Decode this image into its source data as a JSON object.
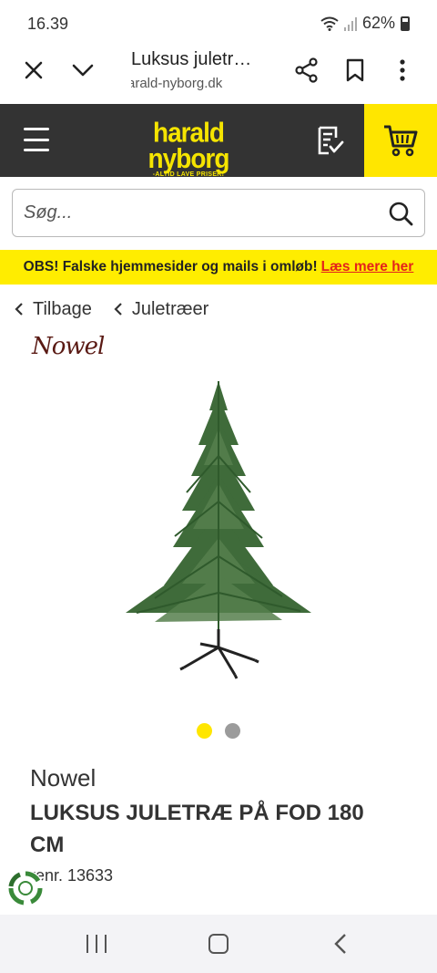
{
  "status_bar": {
    "time": "16.39",
    "battery": "62%"
  },
  "browser": {
    "page_title": "Luksus juletr…",
    "url": "arald-nyborg.dk"
  },
  "header": {
    "logo_text": "harald nyborg",
    "logo_tagline": "-ALTID LAVE PRISER!"
  },
  "search": {
    "placeholder": "Søg..."
  },
  "notice": {
    "text": "OBS! Falske hjemmesider og mails i omløb!",
    "link": "Læs mere her"
  },
  "breadcrumbs": [
    {
      "label": "Tilbage"
    },
    {
      "label": "Juletræer"
    }
  ],
  "product": {
    "brand_logo": "Nowel",
    "brand": "Nowel",
    "title": "LUKSUS JULETRÆ PÅ FOD 180 CM",
    "sku": "renr. 13633",
    "image_dots": {
      "count": 2,
      "active": 1
    }
  },
  "colors": {
    "brand_yellow": "#ffe600",
    "header_bg": "#333333",
    "link_red": "#e4231b",
    "dot_inactive": "#9b9b9b"
  },
  "icons": [
    "close-icon",
    "chevron-down-icon",
    "share-icon",
    "bookmark-icon",
    "more-icon",
    "menu-icon",
    "shopping-list-icon",
    "cart-icon",
    "search-icon",
    "chevron-left-icon",
    "chat-icon"
  ]
}
